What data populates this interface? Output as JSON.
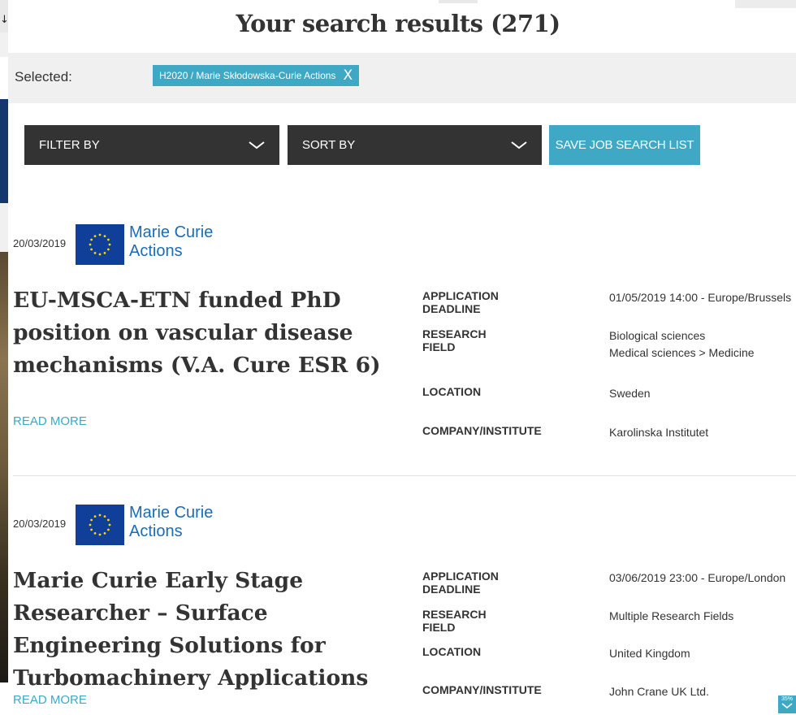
{
  "header": {
    "title": "Your search results (271)"
  },
  "selected": {
    "label": "Selected:",
    "chip": "H2020 / Marie Skłodowska-Curie Actions",
    "chip_close": "X"
  },
  "controls": {
    "filter_label": "FILTER BY",
    "sort_label": "SORT BY",
    "save_label": "SAVE JOB SEARCH LIST"
  },
  "jobs": [
    {
      "date": "20/03/2019",
      "brand_line1": "Marie Curie",
      "brand_line2": "Actions",
      "title": "EU-MSCA-ETN funded PhD position on vascular disease mechanisms (V.A. Cure ESR 6)",
      "read_more": "READ MORE",
      "details": [
        {
          "label": "APPLICATION DEADLINE",
          "values": [
            "01/05/2019 14:00 - Europe/Brussels"
          ]
        },
        {
          "label": "RESEARCH FIELD",
          "values": [
            "Biological sciences",
            "Medical sciences > Medicine"
          ]
        },
        {
          "label": "LOCATION",
          "values": [
            "Sweden"
          ]
        },
        {
          "label": "COMPANY/INSTITUTE",
          "values": [
            "Karolinska Institutet"
          ]
        }
      ]
    },
    {
      "date": "20/03/2019",
      "brand_line1": "Marie Curie",
      "brand_line2": "Actions",
      "title": "Marie Curie Early Stage Researcher – Surface Engineering Solutions for Turbomachinery Applications",
      "read_more": "READ MORE",
      "details": [
        {
          "label": "APPLICATION DEADLINE",
          "values": [
            "03/06/2019 23:00 - Europe/London"
          ]
        },
        {
          "label": "RESEARCH FIELD",
          "values": [
            "Multiple Research Fields"
          ]
        },
        {
          "label": "LOCATION",
          "values": [
            "United Kingdom"
          ]
        },
        {
          "label": "COMPANY/INSTITUTE",
          "values": [
            "John Crane UK Ltd."
          ]
        }
      ]
    }
  ],
  "scroll_indicator": {
    "percent": "35%"
  },
  "left_edge": {
    "arrow": "↓"
  },
  "colors": {
    "accent": "#3ea8c5",
    "dark": "#333333",
    "eu_blue": "#0f3f99",
    "brand_blue": "#1a6cb8"
  },
  "icons": [
    "chevron-down-icon",
    "close-icon",
    "eu-flag-icon",
    "scroll-down-icon"
  ]
}
